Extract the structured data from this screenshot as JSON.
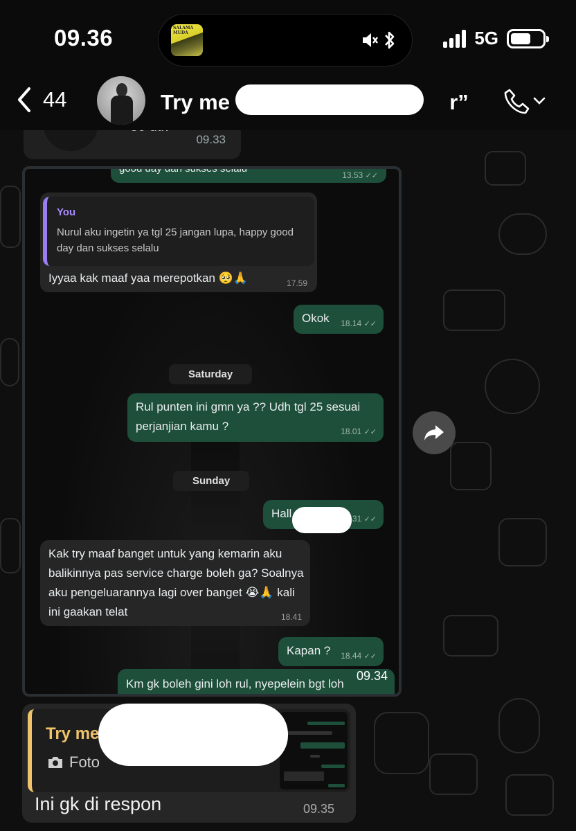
{
  "status_bar": {
    "time": "09.36",
    "network": "5G",
    "now_playing_art_text": "SALAMA\nMUDA",
    "icons": [
      "mute-icon",
      "bluetooth-icon",
      "signal-icon",
      "battery-icon"
    ]
  },
  "header": {
    "back_count": "44",
    "contact_name_prefix": "Try me",
    "contact_name_suffix": "r”",
    "icons": [
      "back-icon",
      "phone-icon",
      "chevron-down-icon"
    ]
  },
  "previous_message": {
    "duration": "30 dtk",
    "time": "09.33"
  },
  "screenshot": {
    "top_partial": {
      "text": "good day dan sukses selalu",
      "time": "13.53"
    },
    "quoted": {
      "author": "You",
      "text": "Nurul aku ingetin ya tgl 25 jangan lupa, happy good day dan sukses selalu"
    },
    "reply1": {
      "text": "Iyyaa kak maaf yaa merepotkan 🥺🙏",
      "time": "17.59"
    },
    "okok": {
      "text": "Okok",
      "time": "18.14"
    },
    "day1": "Saturday",
    "msg_rul": {
      "text": "Rul punten ini gmn ya ?? Udh tgl 25 sesuai perjanjian kamu ?",
      "time": "18.01"
    },
    "day2": "Sunday",
    "hall": {
      "text": "Hall",
      "time": "31"
    },
    "long_in": {
      "text": "Kak try maaf banget untuk yang kemarin aku balikinnya pas service charge boleh ga? Soalnya aku pengeluarannya lagi over banget 😭🙏 kali ini gaakan telat",
      "time": "18.41"
    },
    "kapan": {
      "text": "Kapan ?",
      "time": "18.44"
    },
    "last": {
      "text": "Km gk boleh gini loh rul, nyepelein bgt loh"
    }
  },
  "image_message_time": "09.34",
  "reply_message": {
    "quoted_name": "Try me “",
    "quoted_type": "Foto",
    "text": "Ini gk di respon",
    "time": "09.35"
  },
  "colors": {
    "outgoing_bubble": "#1e4f3a",
    "incoming_bubble": "#262626",
    "quote_accent_you": "#9a7df0",
    "quote_accent_contact": "#f0c26a"
  }
}
